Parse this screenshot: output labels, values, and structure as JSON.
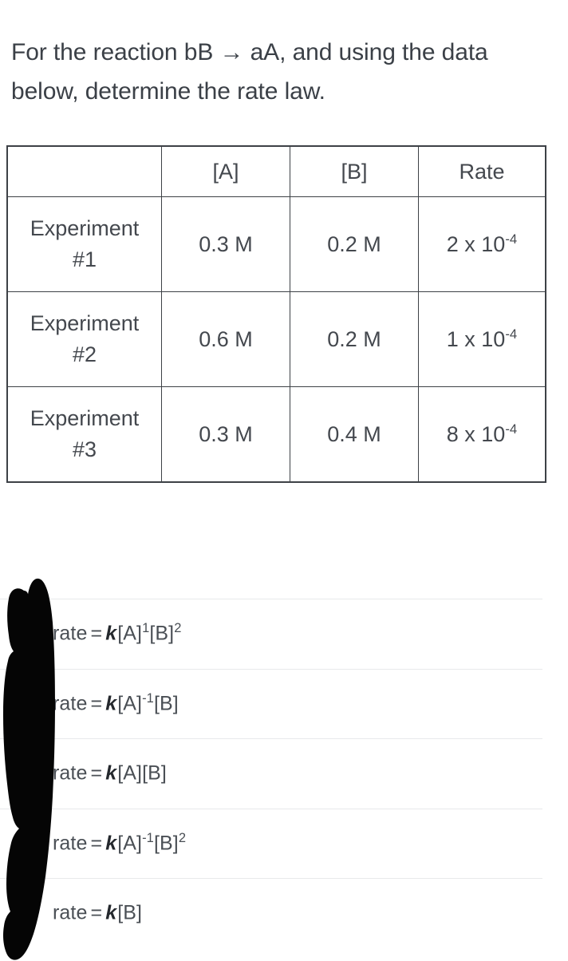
{
  "question": {
    "text": "For the reaction bB → aA, and using the data below, determine the rate law."
  },
  "table": {
    "headers": [
      "",
      "[A]",
      "[B]",
      "Rate"
    ],
    "rows": [
      {
        "label_line1": "Experiment",
        "label_line2": "#1",
        "a": "0.3 M",
        "b": "0.2 M",
        "rate_mantissa": "2 x 10",
        "rate_exponent": "-4"
      },
      {
        "label_line1": "Experiment",
        "label_line2": "#2",
        "a": "0.6 M",
        "b": "0.2 M",
        "rate_mantissa": "1 x 10",
        "rate_exponent": "-4"
      },
      {
        "label_line1": "Experiment",
        "label_line2": "#3",
        "a": "0.3 M",
        "b": "0.4 M",
        "rate_mantissa": "8 x 10",
        "rate_exponent": "-4"
      }
    ]
  },
  "options": [
    {
      "prefix": "rate",
      "equals": "=",
      "k": "k",
      "term1_base": "[A]",
      "term1_exp": "1",
      "term2_base": "[B]",
      "term2_exp": "2"
    },
    {
      "prefix": "rate",
      "equals": "=",
      "k": "k",
      "term1_base": "[A]",
      "term1_exp": "-1",
      "term2_base": "[B]",
      "term2_exp": ""
    },
    {
      "prefix": "rate",
      "equals": "=",
      "k": "k",
      "term1_base": "[A]",
      "term1_exp": "",
      "term2_base": "[B]",
      "term2_exp": ""
    },
    {
      "prefix": "rate",
      "equals": "=",
      "k": "k",
      "term1_base": "[A]",
      "term1_exp": "-1",
      "term2_base": "[B]",
      "term2_exp": "2"
    },
    {
      "prefix": "rate",
      "equals": "=",
      "k": "k",
      "term1_base": "[B]",
      "term1_exp": "",
      "term2_base": "",
      "term2_exp": ""
    }
  ],
  "annotation": {
    "redaction_color": "#050505"
  },
  "colors": {
    "text": "#3b4047",
    "table_border": "#3d4146",
    "divider": "#e8e9eb",
    "background": "#ffffff"
  }
}
